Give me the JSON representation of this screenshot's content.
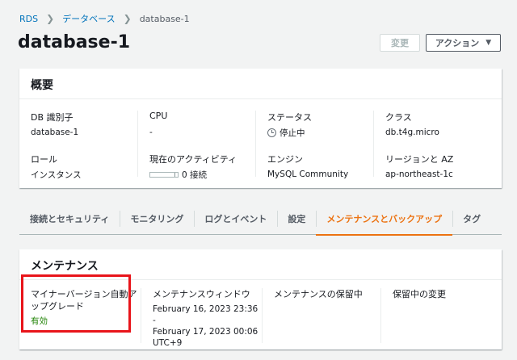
{
  "breadcrumb": {
    "root": "RDS",
    "section": "データベース",
    "current": "database-1"
  },
  "page_title": "database-1",
  "buttons": {
    "change": "変更",
    "actions": "アクション"
  },
  "summary": {
    "header": "概要",
    "db_id_label": "DB 識別子",
    "db_id_value": "database-1",
    "cpu_label": "CPU",
    "cpu_value": "-",
    "status_label": "ステータス",
    "status_value": "停止中",
    "class_label": "クラス",
    "class_value": "db.t4g.micro",
    "role_label": "ロール",
    "role_value": "インスタンス",
    "activity_label": "現在のアクティビティ",
    "activity_value": "0 接続",
    "engine_label": "エンジン",
    "engine_value": "MySQL Community",
    "region_label": "リージョンと AZ",
    "region_value": "ap-northeast-1c"
  },
  "tabs": [
    {
      "label": "接続とセキュリティ",
      "active": false
    },
    {
      "label": "モニタリング",
      "active": false
    },
    {
      "label": "ログとイベント",
      "active": false
    },
    {
      "label": "設定",
      "active": false
    },
    {
      "label": "メンテナンスとバックアップ",
      "active": true
    },
    {
      "label": "タグ",
      "active": false
    }
  ],
  "maintenance": {
    "header": "メンテナンス",
    "auto_upgrade_label_1": "マイナーバージョン自動ア",
    "auto_upgrade_label_2": "ップグレード",
    "auto_upgrade_value": "有効",
    "window_label": "メンテナンスウィンドウ",
    "window_value_1": "February 16, 2023 23:36 -",
    "window_value_2": "February 17, 2023 00:06",
    "window_value_3": "UTC+9",
    "pending_label": "メンテナンスの保留中",
    "pending_changes_label": "保留中の変更"
  },
  "colors": {
    "accent": "#ec7211",
    "link": "#0073bb",
    "enabled": "#1d8102",
    "highlight": "#e8141a"
  }
}
